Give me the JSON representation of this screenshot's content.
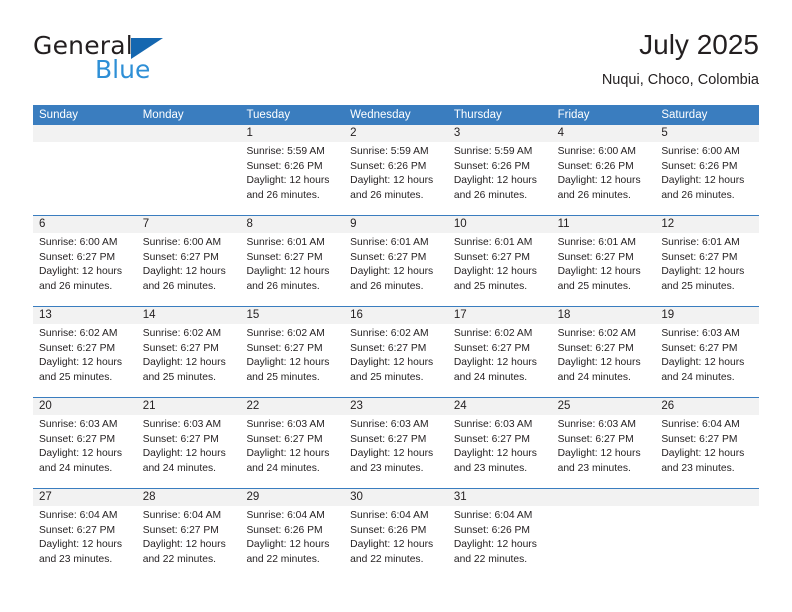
{
  "brand": {
    "word_one": "General",
    "word_two": "Blue",
    "triangle_color": "#1567b0",
    "blue_color": "#2e8fd6"
  },
  "header": {
    "title": "July 2025",
    "subtitle": "Nuqui, Choco, Colombia"
  },
  "colors": {
    "header_blue": "#3a7dbf",
    "daynum_bg": "#f2f2f2",
    "text": "#231f20"
  },
  "weekdays": [
    "Sunday",
    "Monday",
    "Tuesday",
    "Wednesday",
    "Thursday",
    "Friday",
    "Saturday"
  ],
  "weeks": [
    [
      {
        "day": "",
        "lines": []
      },
      {
        "day": "",
        "lines": []
      },
      {
        "day": "1",
        "lines": [
          "Sunrise: 5:59 AM",
          "Sunset: 6:26 PM",
          "Daylight: 12 hours",
          "and 26 minutes."
        ]
      },
      {
        "day": "2",
        "lines": [
          "Sunrise: 5:59 AM",
          "Sunset: 6:26 PM",
          "Daylight: 12 hours",
          "and 26 minutes."
        ]
      },
      {
        "day": "3",
        "lines": [
          "Sunrise: 5:59 AM",
          "Sunset: 6:26 PM",
          "Daylight: 12 hours",
          "and 26 minutes."
        ]
      },
      {
        "day": "4",
        "lines": [
          "Sunrise: 6:00 AM",
          "Sunset: 6:26 PM",
          "Daylight: 12 hours",
          "and 26 minutes."
        ]
      },
      {
        "day": "5",
        "lines": [
          "Sunrise: 6:00 AM",
          "Sunset: 6:26 PM",
          "Daylight: 12 hours",
          "and 26 minutes."
        ]
      }
    ],
    [
      {
        "day": "6",
        "lines": [
          "Sunrise: 6:00 AM",
          "Sunset: 6:27 PM",
          "Daylight: 12 hours",
          "and 26 minutes."
        ]
      },
      {
        "day": "7",
        "lines": [
          "Sunrise: 6:00 AM",
          "Sunset: 6:27 PM",
          "Daylight: 12 hours",
          "and 26 minutes."
        ]
      },
      {
        "day": "8",
        "lines": [
          "Sunrise: 6:01 AM",
          "Sunset: 6:27 PM",
          "Daylight: 12 hours",
          "and 26 minutes."
        ]
      },
      {
        "day": "9",
        "lines": [
          "Sunrise: 6:01 AM",
          "Sunset: 6:27 PM",
          "Daylight: 12 hours",
          "and 26 minutes."
        ]
      },
      {
        "day": "10",
        "lines": [
          "Sunrise: 6:01 AM",
          "Sunset: 6:27 PM",
          "Daylight: 12 hours",
          "and 25 minutes."
        ]
      },
      {
        "day": "11",
        "lines": [
          "Sunrise: 6:01 AM",
          "Sunset: 6:27 PM",
          "Daylight: 12 hours",
          "and 25 minutes."
        ]
      },
      {
        "day": "12",
        "lines": [
          "Sunrise: 6:01 AM",
          "Sunset: 6:27 PM",
          "Daylight: 12 hours",
          "and 25 minutes."
        ]
      }
    ],
    [
      {
        "day": "13",
        "lines": [
          "Sunrise: 6:02 AM",
          "Sunset: 6:27 PM",
          "Daylight: 12 hours",
          "and 25 minutes."
        ]
      },
      {
        "day": "14",
        "lines": [
          "Sunrise: 6:02 AM",
          "Sunset: 6:27 PM",
          "Daylight: 12 hours",
          "and 25 minutes."
        ]
      },
      {
        "day": "15",
        "lines": [
          "Sunrise: 6:02 AM",
          "Sunset: 6:27 PM",
          "Daylight: 12 hours",
          "and 25 minutes."
        ]
      },
      {
        "day": "16",
        "lines": [
          "Sunrise: 6:02 AM",
          "Sunset: 6:27 PM",
          "Daylight: 12 hours",
          "and 25 minutes."
        ]
      },
      {
        "day": "17",
        "lines": [
          "Sunrise: 6:02 AM",
          "Sunset: 6:27 PM",
          "Daylight: 12 hours",
          "and 24 minutes."
        ]
      },
      {
        "day": "18",
        "lines": [
          "Sunrise: 6:02 AM",
          "Sunset: 6:27 PM",
          "Daylight: 12 hours",
          "and 24 minutes."
        ]
      },
      {
        "day": "19",
        "lines": [
          "Sunrise: 6:03 AM",
          "Sunset: 6:27 PM",
          "Daylight: 12 hours",
          "and 24 minutes."
        ]
      }
    ],
    [
      {
        "day": "20",
        "lines": [
          "Sunrise: 6:03 AM",
          "Sunset: 6:27 PM",
          "Daylight: 12 hours",
          "and 24 minutes."
        ]
      },
      {
        "day": "21",
        "lines": [
          "Sunrise: 6:03 AM",
          "Sunset: 6:27 PM",
          "Daylight: 12 hours",
          "and 24 minutes."
        ]
      },
      {
        "day": "22",
        "lines": [
          "Sunrise: 6:03 AM",
          "Sunset: 6:27 PM",
          "Daylight: 12 hours",
          "and 24 minutes."
        ]
      },
      {
        "day": "23",
        "lines": [
          "Sunrise: 6:03 AM",
          "Sunset: 6:27 PM",
          "Daylight: 12 hours",
          "and 23 minutes."
        ]
      },
      {
        "day": "24",
        "lines": [
          "Sunrise: 6:03 AM",
          "Sunset: 6:27 PM",
          "Daylight: 12 hours",
          "and 23 minutes."
        ]
      },
      {
        "day": "25",
        "lines": [
          "Sunrise: 6:03 AM",
          "Sunset: 6:27 PM",
          "Daylight: 12 hours",
          "and 23 minutes."
        ]
      },
      {
        "day": "26",
        "lines": [
          "Sunrise: 6:04 AM",
          "Sunset: 6:27 PM",
          "Daylight: 12 hours",
          "and 23 minutes."
        ]
      }
    ],
    [
      {
        "day": "27",
        "lines": [
          "Sunrise: 6:04 AM",
          "Sunset: 6:27 PM",
          "Daylight: 12 hours",
          "and 23 minutes."
        ]
      },
      {
        "day": "28",
        "lines": [
          "Sunrise: 6:04 AM",
          "Sunset: 6:27 PM",
          "Daylight: 12 hours",
          "and 22 minutes."
        ]
      },
      {
        "day": "29",
        "lines": [
          "Sunrise: 6:04 AM",
          "Sunset: 6:26 PM",
          "Daylight: 12 hours",
          "and 22 minutes."
        ]
      },
      {
        "day": "30",
        "lines": [
          "Sunrise: 6:04 AM",
          "Sunset: 6:26 PM",
          "Daylight: 12 hours",
          "and 22 minutes."
        ]
      },
      {
        "day": "31",
        "lines": [
          "Sunrise: 6:04 AM",
          "Sunset: 6:26 PM",
          "Daylight: 12 hours",
          "and 22 minutes."
        ]
      },
      {
        "day": "",
        "lines": []
      },
      {
        "day": "",
        "lines": []
      }
    ]
  ]
}
